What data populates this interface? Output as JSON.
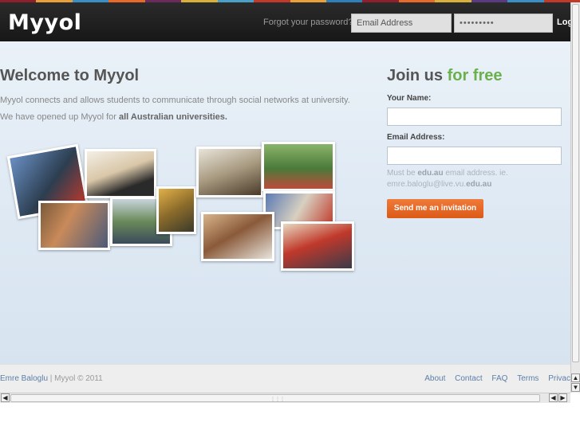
{
  "header": {
    "logo": "Myyol",
    "forgot_link": "Forgot your password?",
    "email_placeholder": "Email Address",
    "password_value": "•••••••••",
    "login_label": "Log"
  },
  "hero": {
    "welcome_title": "Welcome to Myyol",
    "intro_line1": "Myyol connects and allows students to communicate through social networks at university.",
    "intro_line2_prefix": "We have opened up Myyol for ",
    "intro_line2_bold": "all Australian universities."
  },
  "signup": {
    "title_prefix": "Join us ",
    "title_accent": "for free",
    "name_label": "Your Name:",
    "email_label": "Email Address:",
    "hint_prefix": "Must be ",
    "hint_domain": "edu.au",
    "hint_middle": " email address. ie.",
    "hint_example": "emre.baloglu@live.vu.",
    "hint_example_bold": "edu.au",
    "button_label": "Send me an invitation"
  },
  "footer": {
    "author": "Emre Baloglu",
    "copyright": " | Myyol © 2011",
    "links": [
      "About",
      "Contact",
      "FAQ",
      "Terms",
      "Privac"
    ]
  },
  "colors": {
    "accent_green": "#6ab04c",
    "button_orange": "#e8672a",
    "link_blue": "#5b7fa8",
    "stripe": [
      "#c0392b",
      "#f39c12",
      "#27ae60",
      "#2980b9",
      "#8e44ad",
      "#e74c3c",
      "#f1c40f",
      "#16a085"
    ]
  }
}
